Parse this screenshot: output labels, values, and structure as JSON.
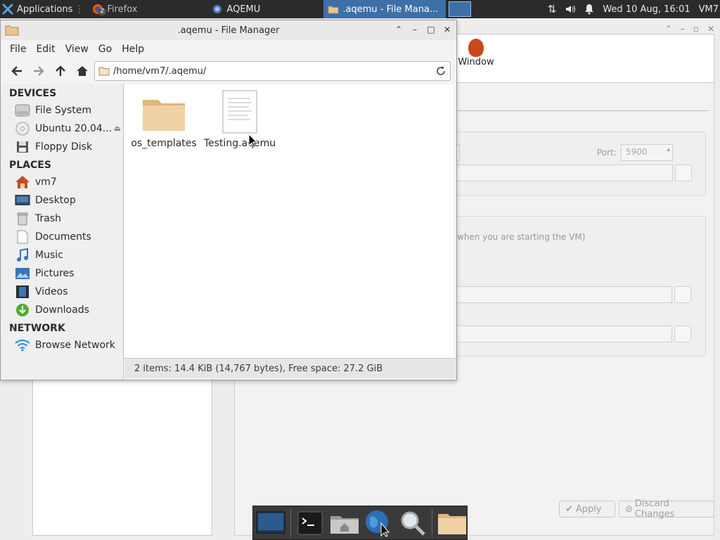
{
  "top_panel": {
    "applications_label": "Applications",
    "firefox_label": "Firefox",
    "firefox_badge": "2",
    "aqemu_label": "AQEMU",
    "file_manager_label": ".aqemu - File Mana...",
    "datetime": "Wed 10 Aug, 16:01",
    "user": "VM7"
  },
  "aqemu_bg": {
    "toolbar_label": "Window",
    "port_label": "Port:",
    "port_value": "5900",
    "hint_text": "when you are starting the VM)",
    "apply_label": "Apply",
    "discard_label": "Discard Changes"
  },
  "file_manager": {
    "title": ".aqemu - File Manager",
    "menu": [
      "File",
      "Edit",
      "View",
      "Go",
      "Help"
    ],
    "path": "/home/vm7/.aqemu/",
    "sidebar": {
      "devices_header": "DEVICES",
      "devices": [
        "File System",
        "Ubuntu 20.04...",
        "Floppy Disk"
      ],
      "places_header": "PLACES",
      "places": [
        "vm7",
        "Desktop",
        "Trash",
        "Documents",
        "Music",
        "Pictures",
        "Videos",
        "Downloads"
      ],
      "network_header": "NETWORK",
      "network": [
        "Browse Network"
      ]
    },
    "files": [
      {
        "name": "os_templates",
        "kind": "folder"
      },
      {
        "name": "Testing.aqemu",
        "kind": "document"
      }
    ],
    "status": "2 items: 14.4 KiB (14,767 bytes), Free space: 27.2 GiB"
  },
  "colors": {
    "panel_bg": "#2b2b2b",
    "active_task": "#3d6fa8",
    "folder": "#e9c592"
  }
}
